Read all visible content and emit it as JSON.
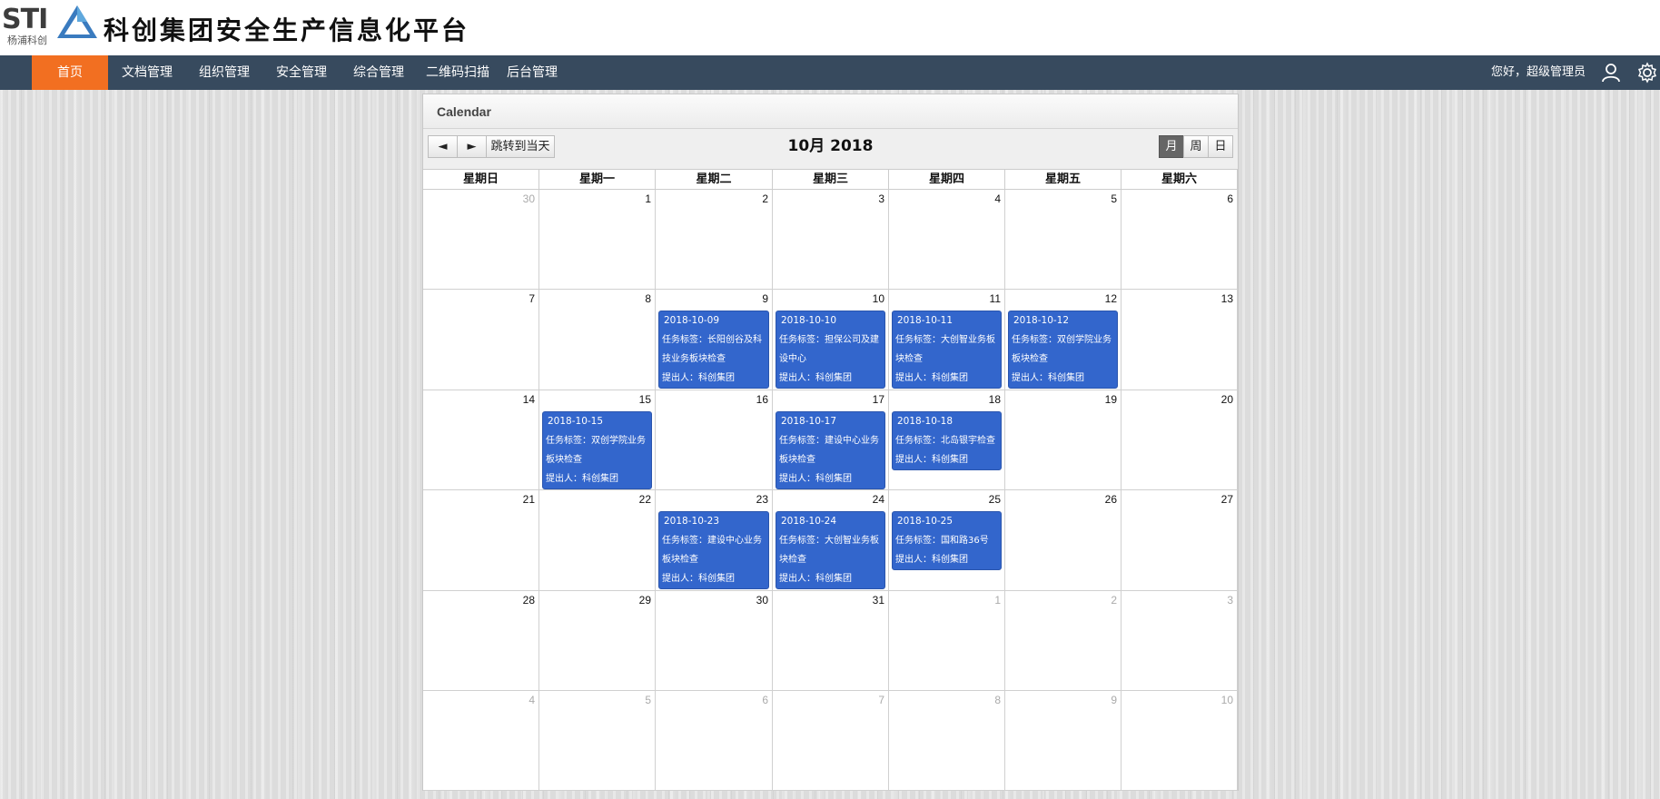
{
  "header": {
    "logo_text": "STI",
    "logo_sub": "杨浦科创",
    "title": "科创集团安全生产信息化平台"
  },
  "nav": {
    "items": [
      "首页",
      "文档管理",
      "组织管理",
      "安全管理",
      "综合管理",
      "二维码扫描",
      "后台管理"
    ],
    "active": "首页",
    "greeting": "您好，超级管理员",
    "icons": [
      "user-icon",
      "gear-icon"
    ]
  },
  "calendar": {
    "panel_title": "Calendar",
    "prev_label": "◄",
    "next_label": "►",
    "today_label": "跳转到当天",
    "title": "10月 2018",
    "views": [
      "月",
      "周",
      "日"
    ],
    "active_view": "月",
    "weekdays": [
      "星期日",
      "星期一",
      "星期二",
      "星期三",
      "星期四",
      "星期五",
      "星期六"
    ],
    "weeks": [
      [
        {
          "d": "30",
          "other": true
        },
        {
          "d": "1"
        },
        {
          "d": "2"
        },
        {
          "d": "3"
        },
        {
          "d": "4"
        },
        {
          "d": "5"
        },
        {
          "d": "6"
        }
      ],
      [
        {
          "d": "7"
        },
        {
          "d": "8"
        },
        {
          "d": "9"
        },
        {
          "d": "10"
        },
        {
          "d": "11"
        },
        {
          "d": "12"
        },
        {
          "d": "13"
        }
      ],
      [
        {
          "d": "14"
        },
        {
          "d": "15"
        },
        {
          "d": "16"
        },
        {
          "d": "17"
        },
        {
          "d": "18"
        },
        {
          "d": "19"
        },
        {
          "d": "20"
        }
      ],
      [
        {
          "d": "21"
        },
        {
          "d": "22"
        },
        {
          "d": "23"
        },
        {
          "d": "24"
        },
        {
          "d": "25"
        },
        {
          "d": "26"
        },
        {
          "d": "27"
        }
      ],
      [
        {
          "d": "28"
        },
        {
          "d": "29"
        },
        {
          "d": "30"
        },
        {
          "d": "31"
        },
        {
          "d": "1",
          "other": true
        },
        {
          "d": "2",
          "other": true
        },
        {
          "d": "3",
          "other": true
        }
      ],
      [
        {
          "d": "4",
          "other": true
        },
        {
          "d": "5",
          "other": true
        },
        {
          "d": "6",
          "other": true
        },
        {
          "d": "7",
          "other": true
        },
        {
          "d": "8",
          "other": true
        },
        {
          "d": "9",
          "other": true
        },
        {
          "d": "10",
          "other": true
        }
      ]
    ],
    "events": [
      {
        "week": 1,
        "day": 2,
        "date": "2018-10-09",
        "lines": [
          "任务标签：长阳创谷及科",
          "技业务板块检查",
          "提出人：科创集团"
        ]
      },
      {
        "week": 1,
        "day": 3,
        "date": "2018-10-10",
        "lines": [
          "任务标签：担保公司及建",
          "设中心",
          "提出人：科创集团"
        ]
      },
      {
        "week": 1,
        "day": 4,
        "date": "2018-10-11",
        "lines": [
          "任务标签：大创智业务板",
          "块检查",
          "提出人：科创集团"
        ]
      },
      {
        "week": 1,
        "day": 5,
        "date": "2018-10-12",
        "lines": [
          "任务标签：双创学院业务",
          "板块检查",
          "提出人：科创集团"
        ]
      },
      {
        "week": 2,
        "day": 1,
        "date": "2018-10-15",
        "lines": [
          "任务标签：双创学院业务",
          "板块检查",
          "提出人：科创集团"
        ]
      },
      {
        "week": 2,
        "day": 3,
        "date": "2018-10-17",
        "lines": [
          "任务标签：建设中心业务",
          "板块检查",
          "提出人：科创集团"
        ]
      },
      {
        "week": 2,
        "day": 4,
        "date": "2018-10-18",
        "lines": [
          "任务标签：北岛银宇检查",
          "提出人：科创集团"
        ]
      },
      {
        "week": 3,
        "day": 2,
        "date": "2018-10-23",
        "lines": [
          "任务标签：建设中心业务",
          "板块检查",
          "提出人：科创集团"
        ]
      },
      {
        "week": 3,
        "day": 3,
        "date": "2018-10-24",
        "lines": [
          "任务标签：大创智业务板",
          "块检查",
          "提出人：科创集团"
        ]
      },
      {
        "week": 3,
        "day": 4,
        "date": "2018-10-25",
        "lines": [
          "任务标签：国和路36号",
          "提出人：科创集团"
        ]
      }
    ]
  },
  "colors": {
    "nav_bg": "#374a5e",
    "nav_active": "#f26f21",
    "event_bg": "#3366cc"
  }
}
